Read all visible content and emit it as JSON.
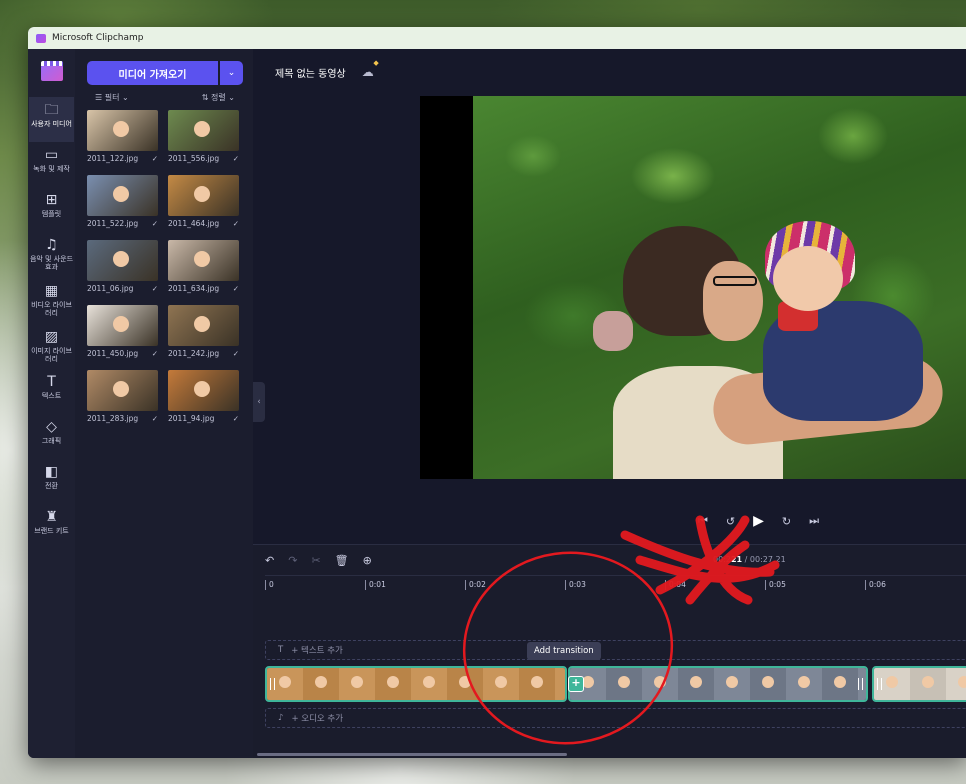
{
  "window": {
    "title": "Microsoft Clipchamp"
  },
  "rail": {
    "items": [
      {
        "label": "사용자 미디어",
        "icon": "folder-icon",
        "active": true
      },
      {
        "label": "녹화 및 제작",
        "icon": "video-camera-icon"
      },
      {
        "label": "템플릿",
        "icon": "templates-icon"
      },
      {
        "label": "음악 및 사운드 효과",
        "icon": "music-note-icon"
      },
      {
        "label": "비디오 라이브러리",
        "icon": "film-icon"
      },
      {
        "label": "이미지 라이브러리",
        "icon": "image-icon"
      },
      {
        "label": "텍스트",
        "icon": "text-icon"
      },
      {
        "label": "그래픽",
        "icon": "shapes-icon"
      },
      {
        "label": "전환",
        "icon": "transition-icon"
      },
      {
        "label": "브랜드 키트",
        "icon": "brand-kit-icon"
      }
    ]
  },
  "media": {
    "import_label": "미디어 가져오기",
    "filter_label": "필터",
    "sort_label": "정렬",
    "files": [
      {
        "name": "2011_122.jpg",
        "color": "#d8c4a8"
      },
      {
        "name": "2011_556.jpg",
        "color": "#6d8a4f"
      },
      {
        "name": "2011_522.jpg",
        "color": "#7a8fb0"
      },
      {
        "name": "2011_464.jpg",
        "color": "#c48a45"
      },
      {
        "name": "2011_06.jpg",
        "color": "#5b6a7d"
      },
      {
        "name": "2011_634.jpg",
        "color": "#c9b8a8"
      },
      {
        "name": "2011_450.jpg",
        "color": "#e8e2da"
      },
      {
        "name": "2011_242.jpg",
        "color": "#8f7452"
      },
      {
        "name": "2011_283.jpg",
        "color": "#b08a66"
      },
      {
        "name": "2011_94.jpg",
        "color": "#c47a3a"
      }
    ]
  },
  "project": {
    "title": "제목 없는 동영상"
  },
  "timeline": {
    "timecode_current": "00:2",
    "timecode_current_bold": "21",
    "timecode_total": "/ 00:27.21",
    "ticks": [
      "0",
      "0:01",
      "0:02",
      "0:03",
      "0:04",
      "0:05",
      "0:06"
    ],
    "text_track_label": "+ 텍스트 추가",
    "audio_track_label": "+ 오디오 추가",
    "transition_tooltip": "Add transition"
  },
  "colors": {
    "accent": "#5b52ef",
    "clip_border": "#3fb69a",
    "annotation": "#e3191f"
  }
}
